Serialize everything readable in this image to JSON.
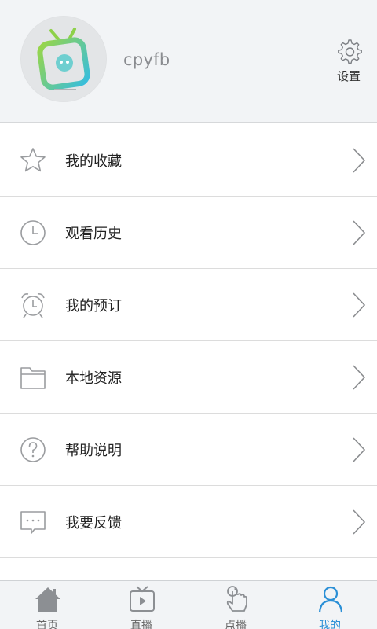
{
  "profile": {
    "username": "cpyfb",
    "settings_label": "设置",
    "avatar_icon": "tv-logo-icon"
  },
  "menu": {
    "items": [
      {
        "label": "我的收藏",
        "icon": "star-icon"
      },
      {
        "label": "观看历史",
        "icon": "clock-icon"
      },
      {
        "label": "我的预订",
        "icon": "alarm-clock-icon"
      },
      {
        "label": "本地资源",
        "icon": "folder-icon"
      },
      {
        "label": "帮助说明",
        "icon": "help-icon"
      },
      {
        "label": "我要反馈",
        "icon": "feedback-icon"
      }
    ]
  },
  "tabbar": {
    "tabs": [
      {
        "label": "首页",
        "icon": "home-icon"
      },
      {
        "label": "直播",
        "icon": "tv-play-icon"
      },
      {
        "label": "点播",
        "icon": "hand-pointer-icon"
      },
      {
        "label": "我的",
        "icon": "person-icon",
        "active": true
      }
    ]
  },
  "colors": {
    "accent": "#2a8fd6",
    "header_bg": "#f2f4f6",
    "icon_gray": "#9a9c9f",
    "logo_green": "#8ed14a",
    "logo_teal": "#3fc1d6"
  }
}
